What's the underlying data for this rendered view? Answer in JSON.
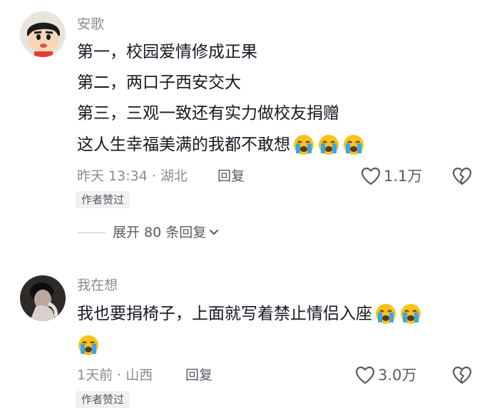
{
  "comments": [
    {
      "username": "安歌",
      "lines": [
        "第一，校园爱情修成正果",
        "第二，两口子西安交大",
        "第三，三观一致还有实力做校友捐赠",
        "这人生幸福美满的我都不敢想"
      ],
      "emoji_name": "loudly-crying-face",
      "emoji_count": 3,
      "time_location": "昨天 13:34 · 湖北",
      "reply_label": "回复",
      "likes": "1.1万",
      "badge": "作者赞过",
      "expand_label": "展开 80 条回复"
    },
    {
      "username": "我在想",
      "lines": [
        "我也要捐椅子，上面就写着禁止情侣入座"
      ],
      "emoji_name": "loudly-crying-face",
      "emoji_count": 3,
      "time_location": "1天前 · 山西",
      "reply_label": "回复",
      "likes": "3.0万",
      "badge": "作者赞过"
    }
  ],
  "icons": {
    "like": "heart-outline-icon",
    "dislike": "broken-heart-icon",
    "expand": "chevron-down-icon"
  },
  "colors": {
    "text_primary": "#161823",
    "text_secondary": "#8a8b91",
    "badge_bg": "#f1f1f2",
    "emoji_yellow": "#fcc21b",
    "emoji_tears": "#3aa7ea"
  }
}
